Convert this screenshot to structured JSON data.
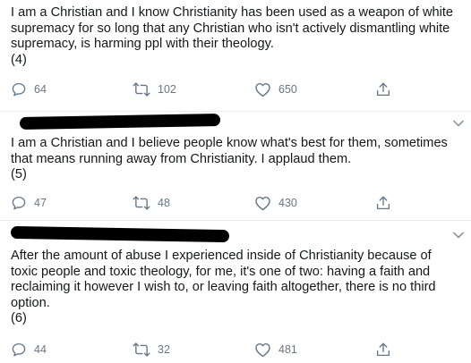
{
  "tweets": [
    {
      "text_lines": [
        "I am a Christian and I know Christianity has been used as a weapon of white",
        "supremacy for so long that any Christian who isn't actively dismantling white",
        "supremacy, is harming ppl with their theology."
      ],
      "number_label": "(4)",
      "replies": "64",
      "retweets": "102",
      "likes": "650"
    },
    {
      "text_lines": [
        "I am a Christian and I believe people know what's best for them, sometimes",
        "that means running away from Christianity. I applaud them."
      ],
      "number_label": "(5)",
      "replies": "47",
      "retweets": "48",
      "likes": "430"
    },
    {
      "text_lines": [
        "After the amount of abuse I experienced inside of Christianity because of",
        "toxic people and toxic theology, for me, it's one of two: having a faith and",
        "reclaiming it however I wish to, or leaving faith altogether, there is no third",
        "option."
      ],
      "number_label": "(6)",
      "replies": "44",
      "retweets": "32",
      "likes": "481"
    }
  ],
  "icons": {
    "reply": "reply-icon",
    "retweet": "retweet-icon",
    "like": "heart-icon",
    "share": "share-icon",
    "menu": "chevron-down-icon"
  },
  "colors": {
    "text": "#14171a",
    "icon": "#657786",
    "divider": "#e6ecf0",
    "redaction": "#000000"
  }
}
